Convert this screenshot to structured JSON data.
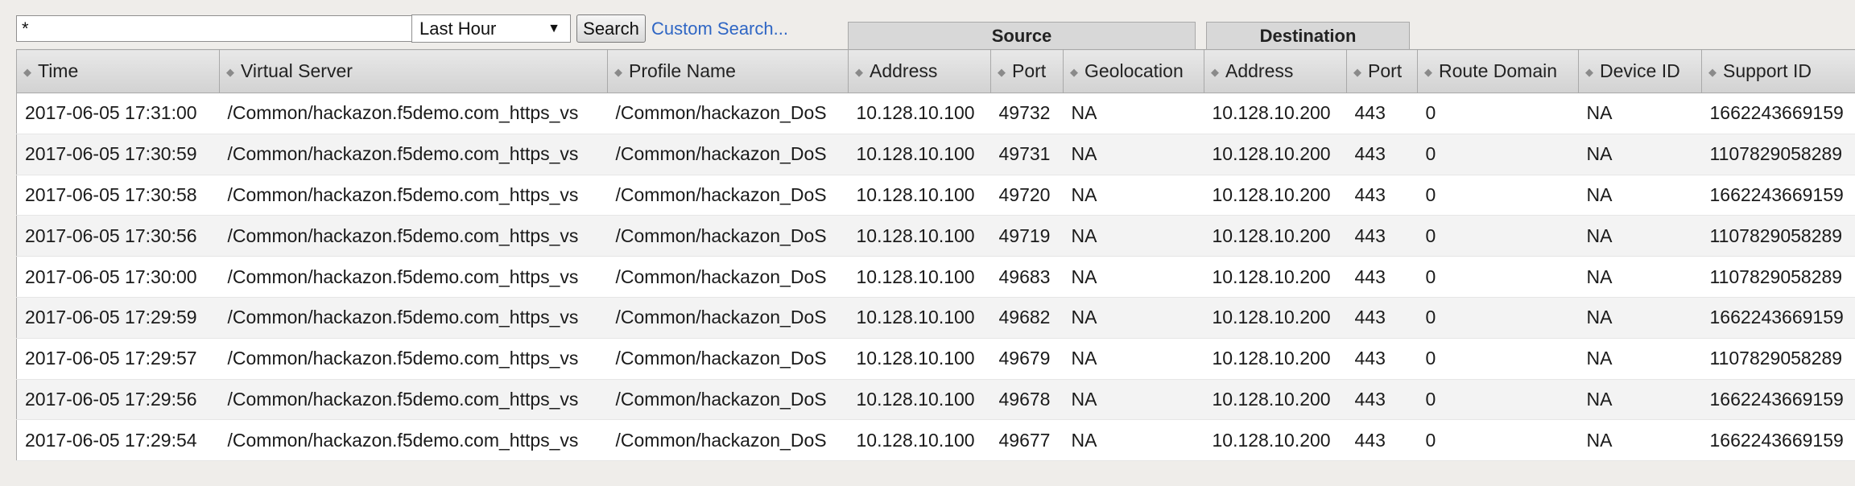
{
  "toolbar": {
    "search_value": "*",
    "range_value": "Last Hour",
    "search_label": "Search",
    "custom_search_label": "Custom Search..."
  },
  "groups": {
    "source": "Source",
    "destination": "Destination"
  },
  "columns": [
    "Time",
    "Virtual Server",
    "Profile Name",
    "Address",
    "Port",
    "Geolocation",
    "Address",
    "Port",
    "Route Domain",
    "Device ID",
    "Support ID"
  ],
  "rows": [
    [
      "2017-06-05 17:31:00",
      "/Common/hackazon.f5demo.com_https_vs",
      "/Common/hackazon_DoS",
      "10.128.10.100",
      "49732",
      "NA",
      "10.128.10.200",
      "443",
      "0",
      "NA",
      "1662243669159"
    ],
    [
      "2017-06-05 17:30:59",
      "/Common/hackazon.f5demo.com_https_vs",
      "/Common/hackazon_DoS",
      "10.128.10.100",
      "49731",
      "NA",
      "10.128.10.200",
      "443",
      "0",
      "NA",
      "1107829058289"
    ],
    [
      "2017-06-05 17:30:58",
      "/Common/hackazon.f5demo.com_https_vs",
      "/Common/hackazon_DoS",
      "10.128.10.100",
      "49720",
      "NA",
      "10.128.10.200",
      "443",
      "0",
      "NA",
      "1662243669159"
    ],
    [
      "2017-06-05 17:30:56",
      "/Common/hackazon.f5demo.com_https_vs",
      "/Common/hackazon_DoS",
      "10.128.10.100",
      "49719",
      "NA",
      "10.128.10.200",
      "443",
      "0",
      "NA",
      "1107829058289"
    ],
    [
      "2017-06-05 17:30:00",
      "/Common/hackazon.f5demo.com_https_vs",
      "/Common/hackazon_DoS",
      "10.128.10.100",
      "49683",
      "NA",
      "10.128.10.200",
      "443",
      "0",
      "NA",
      "1107829058289"
    ],
    [
      "2017-06-05 17:29:59",
      "/Common/hackazon.f5demo.com_https_vs",
      "/Common/hackazon_DoS",
      "10.128.10.100",
      "49682",
      "NA",
      "10.128.10.200",
      "443",
      "0",
      "NA",
      "1662243669159"
    ],
    [
      "2017-06-05 17:29:57",
      "/Common/hackazon.f5demo.com_https_vs",
      "/Common/hackazon_DoS",
      "10.128.10.100",
      "49679",
      "NA",
      "10.128.10.200",
      "443",
      "0",
      "NA",
      "1107829058289"
    ],
    [
      "2017-06-05 17:29:56",
      "/Common/hackazon.f5demo.com_https_vs",
      "/Common/hackazon_DoS",
      "10.128.10.100",
      "49678",
      "NA",
      "10.128.10.200",
      "443",
      "0",
      "NA",
      "1662243669159"
    ],
    [
      "2017-06-05 17:29:54",
      "/Common/hackazon.f5demo.com_https_vs",
      "/Common/hackazon_DoS",
      "10.128.10.100",
      "49677",
      "NA",
      "10.128.10.200",
      "443",
      "0",
      "NA",
      "1662243669159"
    ]
  ]
}
